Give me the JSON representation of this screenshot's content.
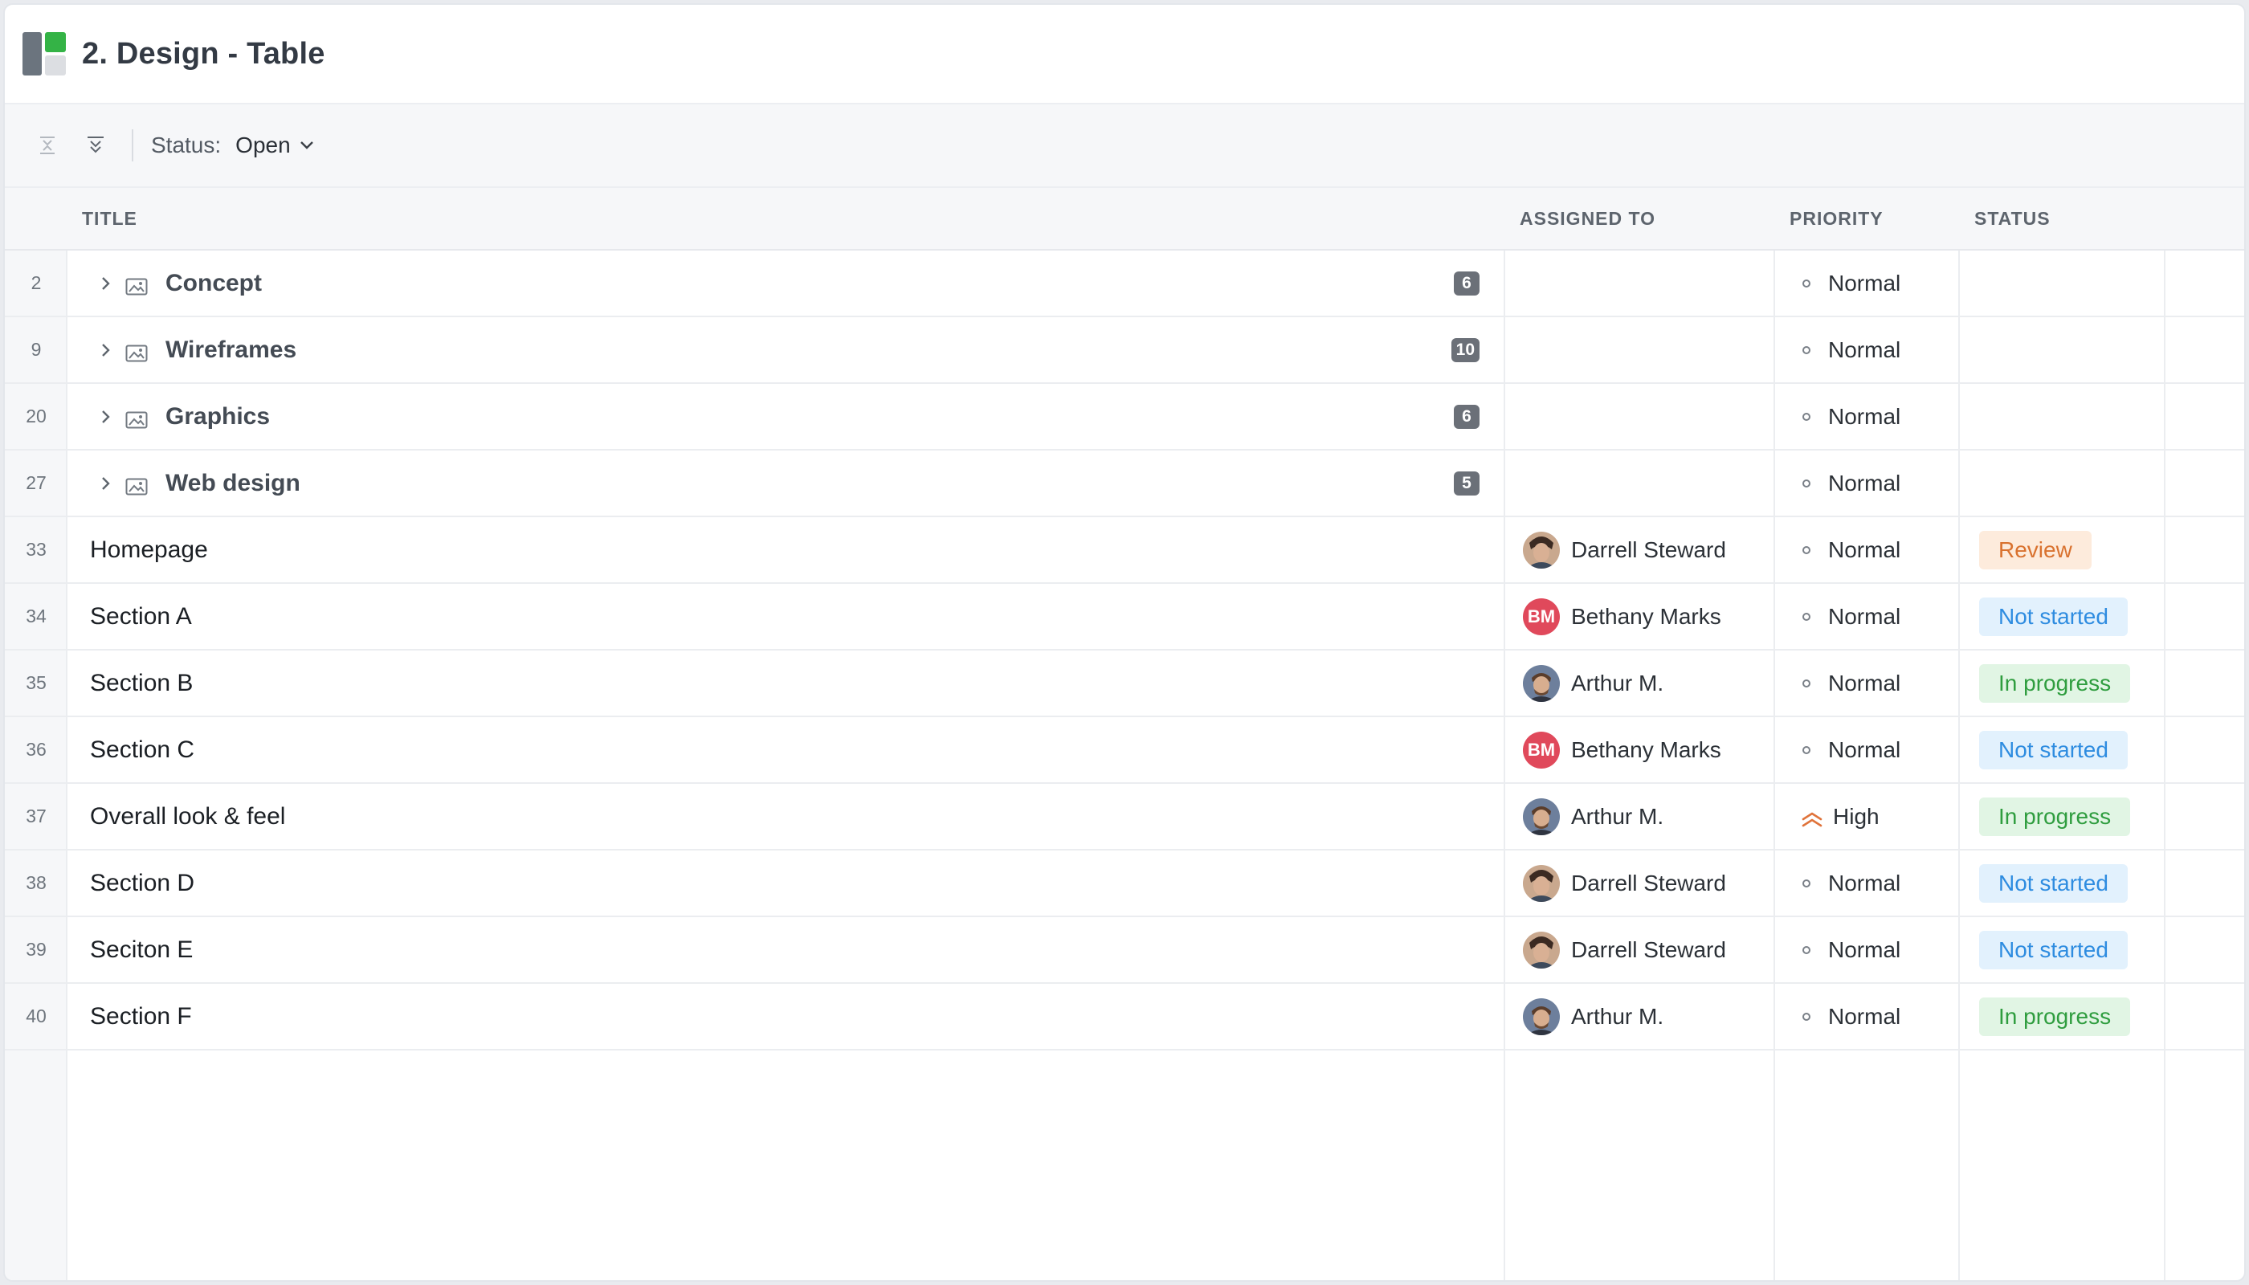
{
  "window": {
    "title": "2. Design - Table"
  },
  "toolbar": {
    "filter_label": "Status:",
    "filter_value": "Open"
  },
  "columns": {
    "title": "TITLE",
    "assigned_to": "ASSIGNED TO",
    "priority": "PRIORITY",
    "status": "STATUS"
  },
  "colors": {
    "review": {
      "bg": "#fdebdc",
      "fg": "#d9722f"
    },
    "not_started": {
      "bg": "#e2f1fd",
      "fg": "#2e8ce0"
    },
    "in_progress": {
      "bg": "#e1f5e4",
      "fg": "#2f9d3f"
    },
    "high_priority": "#e0733a"
  },
  "groups": [
    {
      "row": "2",
      "title": "Concept",
      "count": "6",
      "priority": "Normal"
    },
    {
      "row": "9",
      "title": "Wireframes",
      "count": "10",
      "priority": "Normal"
    },
    {
      "row": "20",
      "title": "Graphics",
      "count": "6",
      "priority": "Normal"
    },
    {
      "row": "27",
      "title": "Web design",
      "count": "5",
      "priority": "Normal"
    }
  ],
  "tasks": [
    {
      "row": "33",
      "title": "Homepage",
      "assignee": "Darrell Steward",
      "avatar": "photo-darrell",
      "priority": "Normal",
      "status": "Review",
      "status_key": "review"
    },
    {
      "row": "34",
      "title": "Section A",
      "assignee": "Bethany Marks",
      "avatar": "initials",
      "initials": "BM",
      "priority": "Normal",
      "status": "Not started",
      "status_key": "not_started"
    },
    {
      "row": "35",
      "title": "Section B",
      "assignee": "Arthur M.",
      "avatar": "photo-arthur",
      "priority": "Normal",
      "status": "In progress",
      "status_key": "in_progress"
    },
    {
      "row": "36",
      "title": "Section C",
      "assignee": "Bethany Marks",
      "avatar": "initials",
      "initials": "BM",
      "priority": "Normal",
      "status": "Not started",
      "status_key": "not_started"
    },
    {
      "row": "37",
      "title": "Overall look & feel",
      "assignee": "Arthur M.",
      "avatar": "photo-arthur",
      "priority": "High",
      "priority_icon": "double-chevron-up-icon",
      "status": "In progress",
      "status_key": "in_progress"
    },
    {
      "row": "38",
      "title": "Section D",
      "assignee": "Darrell Steward",
      "avatar": "photo-darrell",
      "priority": "Normal",
      "status": "Not started",
      "status_key": "not_started"
    },
    {
      "row": "39",
      "title": "Seciton E",
      "assignee": "Darrell Steward",
      "avatar": "photo-darrell",
      "priority": "Normal",
      "status": "Not started",
      "status_key": "not_started"
    },
    {
      "row": "40",
      "title": "Section F",
      "assignee": "Arthur M.",
      "avatar": "photo-arthur",
      "priority": "Normal",
      "status": "In progress",
      "status_key": "in_progress"
    }
  ]
}
